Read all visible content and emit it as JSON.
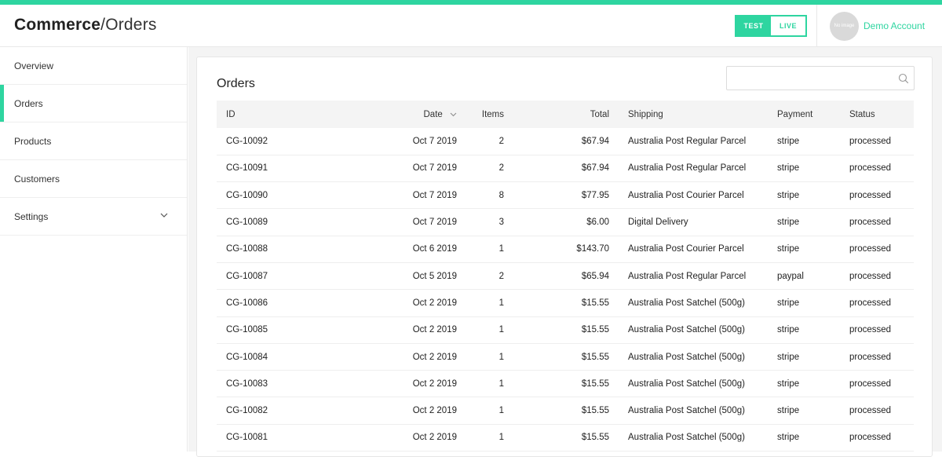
{
  "header": {
    "brand": "Commerce",
    "separator": "/",
    "page": "Orders",
    "mode_toggle": {
      "test_label": "TEST",
      "live_label": "LIVE",
      "active": "TEST"
    },
    "account": {
      "avatar_text": "No image",
      "name": "Demo Account"
    }
  },
  "sidebar": {
    "items": [
      {
        "label": "Overview"
      },
      {
        "label": "Orders",
        "active": true
      },
      {
        "label": "Products"
      },
      {
        "label": "Customers"
      },
      {
        "label": "Settings",
        "icon": "chevron-down-icon"
      }
    ]
  },
  "orders": {
    "title": "Orders",
    "search": {
      "placeholder": "",
      "value": ""
    },
    "columns": [
      "ID",
      "Date",
      "Items",
      "Total",
      "Shipping",
      "Payment",
      "Status"
    ],
    "rows": [
      [
        "CG-10092",
        "Oct 7 2019",
        "2",
        "$67.94",
        "Australia Post Regular Parcel",
        "stripe",
        "processed"
      ],
      [
        "CG-10091",
        "Oct 7 2019",
        "2",
        "$67.94",
        "Australia Post Regular Parcel",
        "stripe",
        "processed"
      ],
      [
        "CG-10090",
        "Oct 7 2019",
        "8",
        "$77.95",
        "Australia Post Courier Parcel",
        "stripe",
        "processed"
      ],
      [
        "CG-10089",
        "Oct 7 2019",
        "3",
        "$6.00",
        "Digital Delivery",
        "stripe",
        "processed"
      ],
      [
        "CG-10088",
        "Oct 6 2019",
        "1",
        "$143.70",
        "Australia Post Courier Parcel",
        "stripe",
        "processed"
      ],
      [
        "CG-10087",
        "Oct 5 2019",
        "2",
        "$65.94",
        "Australia Post Regular Parcel",
        "paypal",
        "processed"
      ],
      [
        "CG-10086",
        "Oct 2 2019",
        "1",
        "$15.55",
        "Australia Post Satchel (500g)",
        "stripe",
        "processed"
      ],
      [
        "CG-10085",
        "Oct 2 2019",
        "1",
        "$15.55",
        "Australia Post Satchel (500g)",
        "stripe",
        "processed"
      ],
      [
        "CG-10084",
        "Oct 2 2019",
        "1",
        "$15.55",
        "Australia Post Satchel (500g)",
        "stripe",
        "processed"
      ],
      [
        "CG-10083",
        "Oct 2 2019",
        "1",
        "$15.55",
        "Australia Post Satchel (500g)",
        "stripe",
        "processed"
      ],
      [
        "CG-10082",
        "Oct 2 2019",
        "1",
        "$15.55",
        "Australia Post Satchel (500g)",
        "stripe",
        "processed"
      ],
      [
        "CG-10081",
        "Oct 2 2019",
        "1",
        "$15.55",
        "Australia Post Satchel (500g)",
        "stripe",
        "processed"
      ]
    ]
  },
  "colors": {
    "accent": "#2ed5a0",
    "header_bg": "#f4f4f4"
  }
}
